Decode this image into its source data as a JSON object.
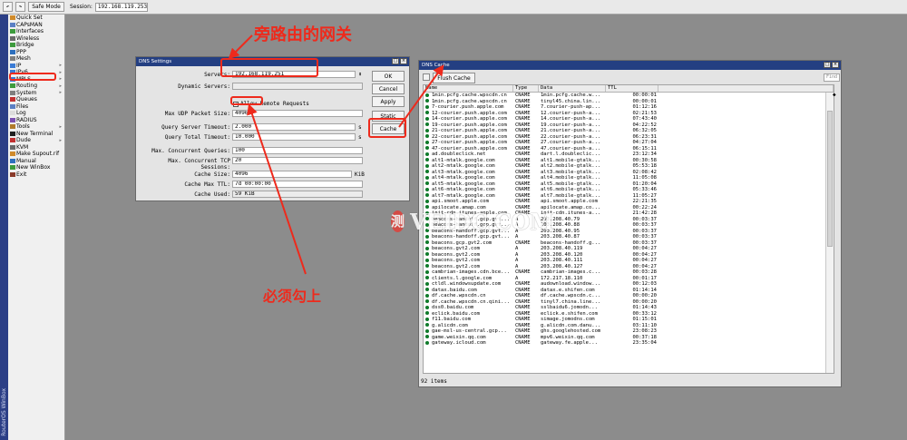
{
  "topbar": {
    "undo_icon": "undo-icon",
    "redo_icon": "redo-icon",
    "safe_mode": "Safe Mode",
    "session_label": "Session:",
    "session_value": "192.168.119.253"
  },
  "rail_text": "RouterOS WinBox",
  "menu": [
    {
      "label": "Quick Set",
      "icon": "quick-set-icon",
      "color": "#d08a2a",
      "arrow": false
    },
    {
      "label": "CAPsMAN",
      "icon": "capsman-icon",
      "color": "#5a7fc4",
      "arrow": false
    },
    {
      "label": "Interfaces",
      "icon": "interfaces-icon",
      "color": "#3d9b3d",
      "arrow": false
    },
    {
      "label": "Wireless",
      "icon": "wireless-icon",
      "color": "#6a6a6a",
      "arrow": false
    },
    {
      "label": "Bridge",
      "icon": "bridge-icon",
      "color": "#3d9b3d",
      "arrow": false
    },
    {
      "label": "PPP",
      "icon": "ppp-icon",
      "color": "#2d6fbd",
      "arrow": false
    },
    {
      "label": "Mesh",
      "icon": "mesh-icon",
      "color": "#7f7f7f",
      "arrow": false
    },
    {
      "label": "IP",
      "icon": "ip-icon",
      "color": "#3a7bd5",
      "arrow": true
    },
    {
      "label": "IPv6",
      "icon": "ipv6-icon",
      "color": "#3a7bd5",
      "arrow": true
    },
    {
      "label": "MPLS",
      "icon": "mpls-icon",
      "color": "#3a7bd5",
      "arrow": true
    },
    {
      "label": "Routing",
      "icon": "routing-icon",
      "color": "#3d9b3d",
      "arrow": true
    },
    {
      "label": "System",
      "icon": "system-icon",
      "color": "#7f7f7f",
      "arrow": true
    },
    {
      "label": "Queues",
      "icon": "queues-icon",
      "color": "#c23030",
      "arrow": false
    },
    {
      "label": "Files",
      "icon": "files-icon",
      "color": "#5a7fc4",
      "arrow": false
    },
    {
      "label": "Log",
      "icon": "log-icon",
      "color": "#dcdcdc",
      "arrow": false
    },
    {
      "label": "RADIUS",
      "icon": "radius-icon",
      "color": "#7a4fb0",
      "arrow": false
    },
    {
      "label": "Tools",
      "icon": "tools-icon",
      "color": "#b07a2a",
      "arrow": true
    },
    {
      "label": "New Terminal",
      "icon": "terminal-icon",
      "color": "#202020",
      "arrow": false
    },
    {
      "label": "Dude",
      "icon": "dude-icon",
      "color": "#c23030",
      "arrow": true
    },
    {
      "label": "KVM",
      "icon": "kvm-icon",
      "color": "#6a6a6a",
      "arrow": false
    },
    {
      "label": "Make Supout.rif",
      "icon": "supout-icon",
      "color": "#d08a2a",
      "arrow": false
    },
    {
      "label": "Manual",
      "icon": "manual-icon",
      "color": "#2d6fbd",
      "arrow": false
    },
    {
      "label": "New WinBox",
      "icon": "winbox-icon",
      "color": "#3d9b3d",
      "arrow": false
    },
    {
      "label": "Exit",
      "icon": "exit-icon",
      "color": "#8a3a2a",
      "arrow": false
    }
  ],
  "dns_settings": {
    "title": "DNS Settings",
    "servers_label": "Servers:",
    "servers_value": "192.168.119.251",
    "dynamic_label": "Dynamic Servers:",
    "dynamic_value": "",
    "allow_remote_label": "Allow Remote Requests",
    "allow_remote_checked": "✔",
    "udp_label": "Max UDP Packet Size:",
    "udp_value": "4096",
    "qst_label": "Query Server Timeout:",
    "qst_value": "2.000",
    "qst_unit": "s",
    "qtt_label": "Query Total Timeout:",
    "qtt_value": "10.000",
    "qtt_unit": "s",
    "mcq_label": "Max. Concurrent Queries:",
    "mcq_value": "100",
    "mtcp_label": "Max. Concurrent TCP Sessions:",
    "mtcp_value": "20",
    "cs_label": "Cache Size:",
    "cs_value": "4096",
    "cs_unit": "KiB",
    "cmt_label": "Cache Max TTL:",
    "cmt_value": "7d 00:00:00",
    "cu_label": "Cache Used:",
    "cu_value": "59 KiB",
    "buttons": [
      "OK",
      "Cancel",
      "Apply",
      "Static",
      "Cache"
    ]
  },
  "dns_cache": {
    "title": "DNS Cache",
    "flush": "Flush Cache",
    "find_placeholder": "Find",
    "columns": [
      "Name",
      "Type",
      "Data",
      "TTL"
    ],
    "rows": [
      [
        "1min.pcfg.cache.wpscdn.cn",
        "CNAME",
        "1min.pcfg.cache.w...",
        "00:00:01"
      ],
      [
        "1min.pcfg.cache.wpscdn.cn",
        "CNAME",
        "tinyl45.china.lin...",
        "00:00:01"
      ],
      [
        "7-courier.push.apple.com",
        "CNAME",
        "7.courier-push-ap...",
        "01:12:16"
      ],
      [
        "12-courier.push.apple.com",
        "CNAME",
        "12.courier-push-a...",
        "02:21:53"
      ],
      [
        "14-courier.push.apple.com",
        "CNAME",
        "14.courier-push-a...",
        "07:43:40"
      ],
      [
        "19-courier.push.apple.com",
        "CNAME",
        "19.courier-push-a...",
        "04:22:52"
      ],
      [
        "21-courier.push.apple.com",
        "CNAME",
        "21.courier-push-a...",
        "06:32:05"
      ],
      [
        "22-courier.push.apple.com",
        "CNAME",
        "22.courier-push-a...",
        "06:23:31"
      ],
      [
        "27-courier.push.apple.com",
        "CNAME",
        "27.courier-push-a...",
        "04:27:04"
      ],
      [
        "47-courier.push.apple.com",
        "CNAME",
        "47.courier-push-a...",
        "06:15:11"
      ],
      [
        "ad.doubleclick.net",
        "CNAME",
        "dart.l.doubleclic...",
        "23:12:34"
      ],
      [
        "alt1-mtalk.google.com",
        "CNAME",
        "alt1.mobile-gtalk...",
        "00:30:58"
      ],
      [
        "alt2-mtalk.google.com",
        "CNAME",
        "alt2.mobile-gtalk...",
        "05:53:18"
      ],
      [
        "alt3-mtalk.google.com",
        "CNAME",
        "alt3.mobile-gtalk...",
        "02:08:42"
      ],
      [
        "alt4-mtalk.google.com",
        "CNAME",
        "alt4.mobile-gtalk...",
        "11:05:08"
      ],
      [
        "alt5-mtalk.google.com",
        "CNAME",
        "alt5.mobile-gtalk...",
        "01:20:04"
      ],
      [
        "alt6-mtalk.google.com",
        "CNAME",
        "alt6.mobile-gtalk...",
        "05:33:46"
      ],
      [
        "alt7-mtalk.google.com",
        "CNAME",
        "alt7.mobile-gtalk...",
        "11:05:27"
      ],
      [
        "api.smoot.apple.com",
        "CNAME",
        "api.smoot.apple.com",
        "22:21:35"
      ],
      [
        "apilocate.amap.com",
        "CNAME",
        "apilocate.amap.co...",
        "00:22:24"
      ],
      [
        "init-cdn.itunes-apple.com",
        "CNAME",
        "init-cdn.itunes-a...",
        "21:42:28"
      ],
      [
        "beacons-handoff.gcp.gvt...",
        "A",
        "203.208.40.79",
        "00:03:37"
      ],
      [
        "beacons-handoff.gcp.gvt...",
        "A",
        "203.208.40.88",
        "00:03:37"
      ],
      [
        "beacons-handoff.gcp.gvt...",
        "A",
        "203.208.40.95",
        "00:03:37"
      ],
      [
        "beacons-handoff.gcp.gvt...",
        "A",
        "203.208.40.87",
        "00:03:37"
      ],
      [
        "beacons.gcp.gvt2.com",
        "CNAME",
        "beacons-handoff.g...",
        "00:03:37"
      ],
      [
        "beacons.gvt2.com",
        "A",
        "203.208.40.119",
        "00:04:27"
      ],
      [
        "beacons.gvt2.com",
        "A",
        "203.208.40.120",
        "00:04:27"
      ],
      [
        "beacons.gvt2.com",
        "A",
        "203.208.40.111",
        "00:04:27"
      ],
      [
        "beacons.gvt2.com",
        "A",
        "203.208.40.127",
        "00:04:27"
      ],
      [
        "cambrian-images.cdn.bce...",
        "CNAME",
        "cambrian-images.c...",
        "00:03:28"
      ],
      [
        "clients.l.google.com",
        "A",
        "172.217.18.110",
        "00:01:17"
      ],
      [
        "ctldl.windowsupdate.com",
        "CNAME",
        "audownload.window...",
        "00:12:03"
      ],
      [
        "datax.baidu.com",
        "CNAME",
        "datax.e.shifen.com",
        "01:14:14"
      ],
      [
        "df.cache.wpscdn.cn",
        "CNAME",
        "df.cache.wpscdn.c...",
        "00:00:20"
      ],
      [
        "df.cache.wpscdn.cn.qini...",
        "CNAME",
        "tinyl7.china.line...",
        "00:00:20"
      ],
      [
        "dss0.baidu.com",
        "CNAME",
        "sslbaidu6.jomodn...",
        "01:14:43"
      ],
      [
        "eclick.baidu.com",
        "CNAME",
        "eclick.e.shifen.com",
        "00:33:12"
      ],
      [
        "f11.baidu.com",
        "CNAME",
        "simage.jomodns.com",
        "01:15:01"
      ],
      [
        "g.alicdn.com",
        "CNAME",
        "g.alicdn.com.danu...",
        "03:11:10"
      ],
      [
        "gae-msl-us-central.gcp...",
        "CNAME",
        "ghs.googlehosted.com",
        "23:08:23"
      ],
      [
        "game.weixin.qq.com",
        "CNAME",
        "mpv6.weixin.qq.com",
        "00:37:18"
      ],
      [
        "gateway.icloud.com",
        "CNAME",
        "gateway.fe.apple...",
        "23:35:04"
      ]
    ],
    "status": "92 items"
  },
  "annotations": {
    "gateway": "旁路由的网关",
    "must_check": "必须勾上",
    "accent": "#ee2a1c"
  },
  "watermark": {
    "logo": "测",
    "text": "VEIDC.COM"
  }
}
